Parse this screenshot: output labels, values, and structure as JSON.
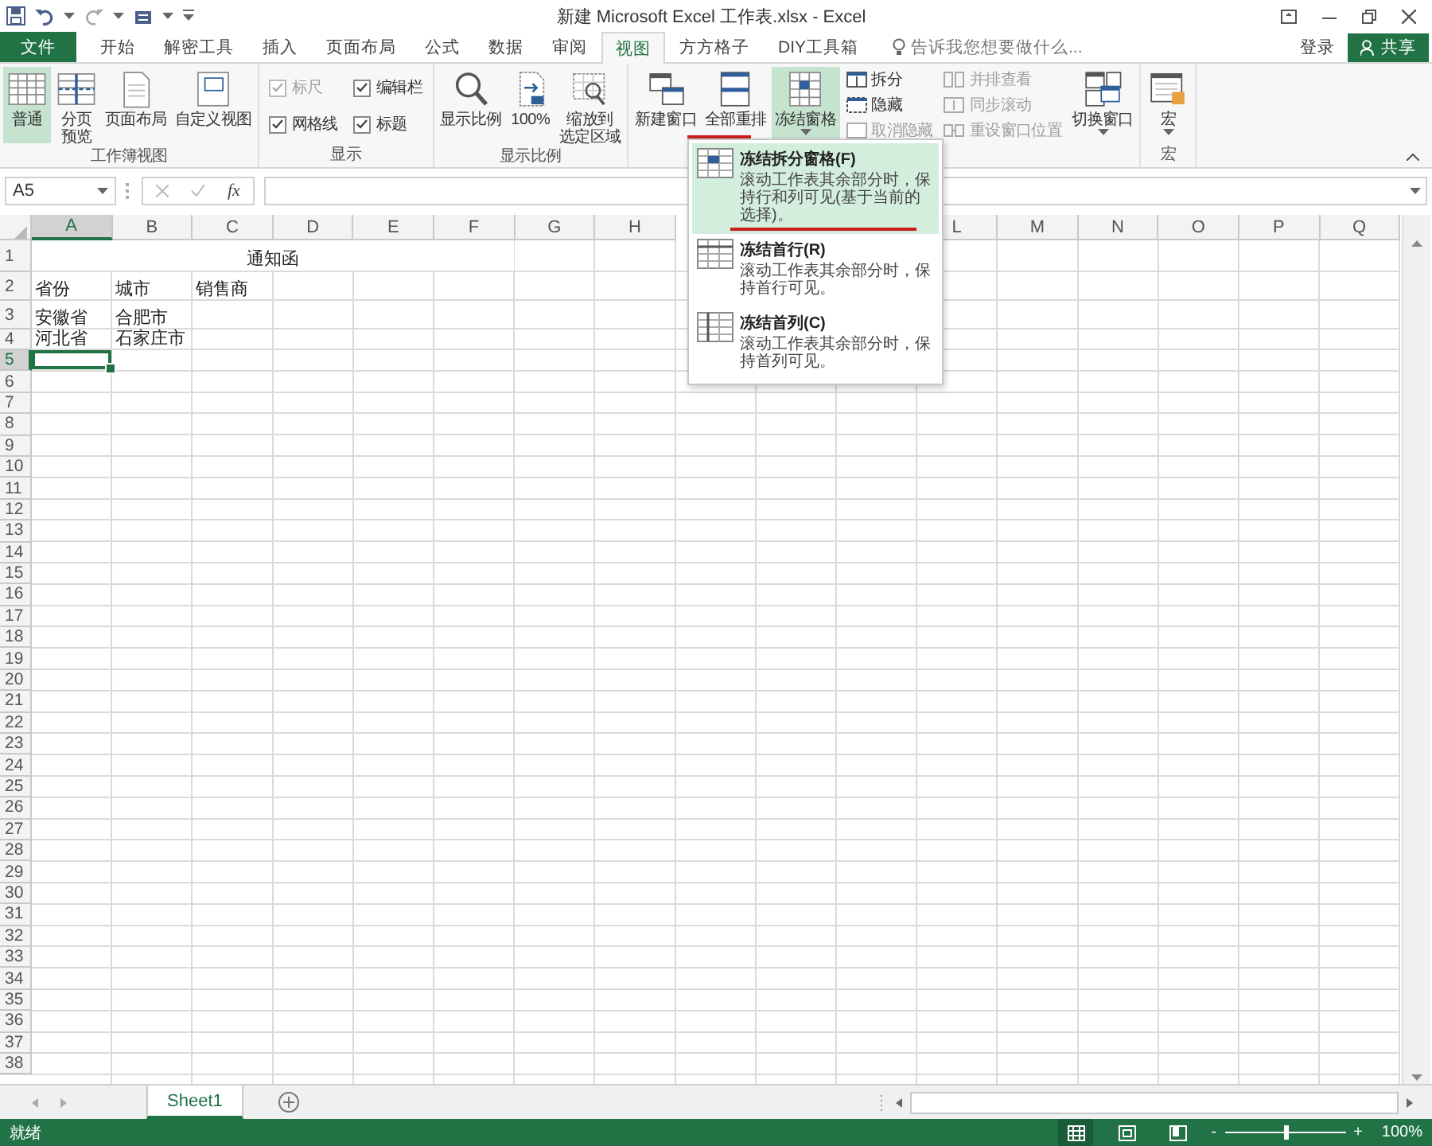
{
  "title_bar": {
    "title": "新建 Microsoft Excel 工作表.xlsx - Excel"
  },
  "tabs": [
    {
      "label": "文件",
      "kind": "file",
      "selected": false
    },
    {
      "label": "开始",
      "kind": "tab",
      "selected": false
    },
    {
      "label": "解密工具",
      "kind": "tab",
      "selected": false
    },
    {
      "label": "插入",
      "kind": "tab",
      "selected": false
    },
    {
      "label": "页面布局",
      "kind": "tab",
      "selected": false
    },
    {
      "label": "公式",
      "kind": "tab",
      "selected": false
    },
    {
      "label": "数据",
      "kind": "tab",
      "selected": false
    },
    {
      "label": "审阅",
      "kind": "tab",
      "selected": false
    },
    {
      "label": "视图",
      "kind": "tab",
      "selected": true
    },
    {
      "label": "方方格子",
      "kind": "tab",
      "selected": false
    },
    {
      "label": "DIY工具箱",
      "kind": "tab",
      "selected": false
    }
  ],
  "tell_me": {
    "placeholder": "告诉我您想要做什么..."
  },
  "sign_in": "登录",
  "share": "共享",
  "ribbon_groups": [
    {
      "label": "工作簿视图",
      "controls": [
        {
          "kind": "large",
          "lines": [
            "普通"
          ],
          "selected": true,
          "dropdown": false
        },
        {
          "kind": "large",
          "lines": [
            "分页",
            "预览"
          ],
          "selected": false,
          "dropdown": false
        },
        {
          "kind": "large",
          "lines": [
            "页面布局"
          ],
          "selected": false,
          "dropdown": false
        },
        {
          "kind": "large",
          "lines": [
            "自定义视图"
          ],
          "selected": false,
          "dropdown": false
        }
      ]
    },
    {
      "label": "显示",
      "controls": [
        {
          "kind": "check",
          "label": "标尺",
          "checked": true,
          "disabled": true
        },
        {
          "kind": "check",
          "label": "编辑栏",
          "checked": true,
          "disabled": false
        },
        {
          "kind": "check",
          "label": "网格线",
          "checked": true,
          "disabled": false
        },
        {
          "kind": "check",
          "label": "标题",
          "checked": true,
          "disabled": false
        }
      ]
    },
    {
      "label": "显示比例",
      "controls": [
        {
          "kind": "large",
          "lines": [
            "显示比例"
          ],
          "selected": false,
          "dropdown": false
        },
        {
          "kind": "large",
          "lines": [
            "100%"
          ],
          "selected": false,
          "dropdown": false
        },
        {
          "kind": "large",
          "lines": [
            "缩放到",
            "选定区域"
          ],
          "selected": false,
          "dropdown": false
        }
      ]
    },
    {
      "controls": [
        {
          "kind": "large",
          "lines": [
            "新建窗口"
          ],
          "selected": false,
          "dropdown": false
        },
        {
          "kind": "large",
          "lines": [
            "全部重排"
          ],
          "selected": false,
          "dropdown": false
        },
        {
          "kind": "large",
          "lines": [
            "冻结窗格"
          ],
          "selected": true,
          "dropdown": true
        },
        {
          "kind": "small",
          "label": "拆分",
          "disabled": false
        },
        {
          "kind": "small",
          "label": "隐藏",
          "disabled": false
        },
        {
          "kind": "small",
          "label": "取消隐藏",
          "disabled": true
        },
        {
          "kind": "small",
          "label": "并排查看",
          "disabled": true
        },
        {
          "kind": "small",
          "label": "同步滚动",
          "disabled": true
        },
        {
          "kind": "small",
          "label": "重设窗口位置",
          "disabled": true
        },
        {
          "kind": "large",
          "lines": [
            "切换窗口"
          ],
          "selected": false,
          "dropdown": true
        }
      ]
    },
    {
      "label": "宏",
      "controls": [
        {
          "kind": "large",
          "lines": [
            "宏"
          ],
          "selected": false,
          "dropdown": true
        }
      ]
    }
  ],
  "formula_bar": {
    "name_box": "A5",
    "function_button": "fx"
  },
  "sheet": {
    "columns": [
      {
        "label": "A",
        "selected": true
      },
      {
        "label": "B",
        "selected": false
      },
      {
        "label": "C",
        "selected": false
      },
      {
        "label": "D",
        "selected": false
      },
      {
        "label": "E",
        "selected": false
      },
      {
        "label": "F",
        "selected": false
      },
      {
        "label": "G",
        "selected": false
      },
      {
        "label": "H",
        "selected": false
      },
      null,
      null,
      null,
      {
        "label": "L",
        "selected": false
      },
      {
        "label": "M",
        "selected": false
      },
      {
        "label": "N",
        "selected": false
      },
      {
        "label": "O",
        "selected": false
      },
      {
        "label": "P",
        "selected": false
      },
      {
        "label": "Q",
        "selected": false
      }
    ],
    "rows": [
      {
        "label": "1",
        "selected": false,
        "cells": [
          {
            "text": "通知函",
            "merged": true
          }
        ]
      },
      {
        "label": "2",
        "selected": false,
        "cells": [
          {
            "text": "省份",
            "merged": false
          },
          {
            "text": "城市",
            "merged": false
          },
          {
            "text": "销售商",
            "merged": false
          }
        ]
      },
      {
        "label": "3",
        "selected": false,
        "cells": [
          {
            "text": "安徽省",
            "merged": false
          },
          {
            "text": "合肥市",
            "merged": false
          }
        ]
      },
      {
        "label": "4",
        "selected": false,
        "cells": [
          {
            "text": "河北省",
            "merged": false
          },
          {
            "text": "石家庄市",
            "merged": false
          }
        ]
      },
      {
        "label": "5",
        "selected": true
      },
      {
        "label": "6",
        "selected": false
      },
      {
        "label": "7",
        "selected": false
      },
      {
        "label": "8",
        "selected": false
      },
      {
        "label": "9",
        "selected": false
      },
      {
        "label": "10",
        "selected": false
      },
      {
        "label": "11",
        "selected": false
      },
      {
        "label": "12",
        "selected": false
      },
      {
        "label": "13",
        "selected": false
      },
      {
        "label": "14",
        "selected": false
      },
      {
        "label": "15",
        "selected": false
      },
      {
        "label": "16",
        "selected": false
      },
      {
        "label": "17",
        "selected": false
      },
      {
        "label": "18",
        "selected": false
      },
      {
        "label": "19",
        "selected": false
      },
      {
        "label": "20",
        "selected": false
      },
      {
        "label": "21",
        "selected": false
      },
      {
        "label": "22",
        "selected": false
      },
      {
        "label": "23",
        "selected": false
      },
      {
        "label": "24",
        "selected": false
      },
      {
        "label": "25",
        "selected": false
      },
      {
        "label": "26",
        "selected": false
      },
      {
        "label": "27",
        "selected": false
      },
      {
        "label": "28",
        "selected": false
      },
      {
        "label": "29",
        "selected": false
      },
      {
        "label": "30",
        "selected": false
      },
      {
        "label": "31",
        "selected": false
      },
      {
        "label": "32",
        "selected": false
      },
      {
        "label": "33",
        "selected": false
      },
      {
        "label": "34",
        "selected": false
      },
      {
        "label": "35",
        "selected": false
      },
      {
        "label": "36",
        "selected": false
      },
      {
        "label": "37",
        "selected": false
      },
      {
        "label": "38",
        "selected": false
      }
    ]
  },
  "dropdown_menu": {
    "items": [
      {
        "title": "冻结拆分窗格(F)",
        "description": "滚动工作表其余部分时，保持行和列可见(基于当前的选择)。",
        "selected": true
      },
      {
        "title": "冻结首行(R)",
        "description": "滚动工作表其余部分时，保持首行可见。",
        "selected": false
      },
      {
        "title": "冻结首列(C)",
        "description": "滚动工作表其余部分时，保持首列可见。",
        "selected": false
      }
    ]
  },
  "sheet_tabs": [
    {
      "label": "Sheet1",
      "selected": true
    }
  ],
  "status_bar": {
    "status": "就绪",
    "views": [
      {
        "selected": true
      },
      {
        "selected": false
      },
      {
        "selected": false
      }
    ],
    "zoom": {
      "minus": "-",
      "plus": "+",
      "level": 0.5,
      "reading": "100%"
    }
  }
}
